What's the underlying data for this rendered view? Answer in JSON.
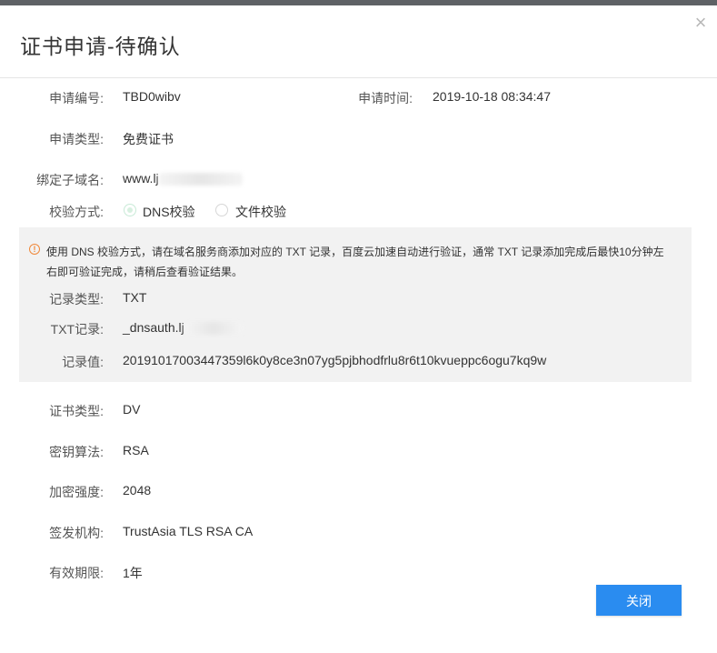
{
  "dialog": {
    "title": "证书申请-待确认",
    "close_icon": "close-icon"
  },
  "fields": {
    "apply_no_label": "申请编号:",
    "apply_no_value": "TBD0wibv",
    "apply_time_label": "申请时间:",
    "apply_time_value": "2019-10-18 08:34:47",
    "apply_type_label": "申请类型:",
    "apply_type_value": "免费证书",
    "subdomain_label": "绑定子域名:",
    "subdomain_value": "www.lj",
    "verify_method_label": "校验方式:",
    "verify_options": [
      {
        "label": "DNS校验",
        "selected": true
      },
      {
        "label": "文件校验",
        "selected": false
      }
    ]
  },
  "notice": {
    "icon": "warning-icon",
    "text": "使用 DNS 校验方式，请在域名服务商添加对应的 TXT 记录，百度云加速自动进行验证，通常 TXT 记录添加完成后最快10分钟左右即可验证完成，请稍后查看验证结果。",
    "record_type_label": "记录类型:",
    "record_type_value": "TXT",
    "txt_record_label": "TXT记录:",
    "txt_record_value": "_dnsauth.lj",
    "record_value_label": "记录值:",
    "record_value_value": "20191017003447359l6k0y8ce3n07yg5pjbhodfrlu8r6t10kvueppc6ogu7kq9w"
  },
  "cert": {
    "cert_type_label": "证书类型:",
    "cert_type_value": "DV",
    "key_alg_label": "密钥算法:",
    "key_alg_value": "RSA",
    "encrypt_strength_label": "加密强度:",
    "encrypt_strength_value": "2048",
    "issuer_label": "签发机构:",
    "issuer_value": "TrustAsia TLS RSA CA",
    "validity_label": "有效期限:",
    "validity_value": "1年"
  },
  "footer": {
    "close_button_label": "关闭",
    "accent_color": "#2a8cf0"
  }
}
